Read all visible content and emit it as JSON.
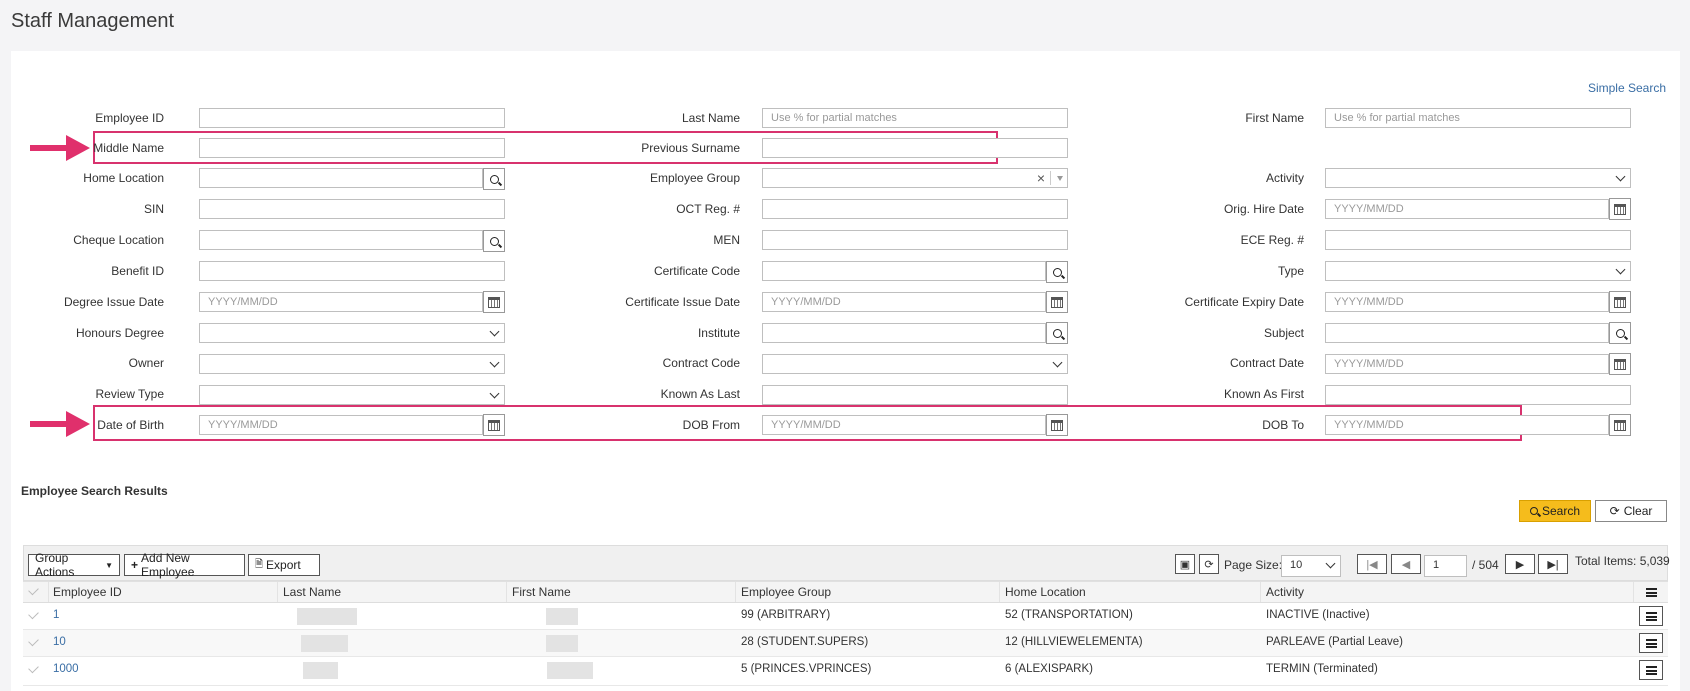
{
  "page": {
    "title": "Staff Management",
    "simple_search": "Simple Search"
  },
  "form": {
    "employee_id": "Employee ID",
    "last_name": "Last Name",
    "first_name": "First Name",
    "middle_name": "Middle Name",
    "previous_surname": "Previous Surname",
    "home_location": "Home Location",
    "employee_group": "Employee Group",
    "activity": "Activity",
    "sin": "SIN",
    "oct_reg": "OCT Reg. #",
    "orig_hire_date": "Orig. Hire Date",
    "cheque_location": "Cheque Location",
    "men": "MEN",
    "ece_reg": "ECE Reg. #",
    "benefit_id": "Benefit ID",
    "certificate_code": "Certificate Code",
    "type": "Type",
    "degree_issue_date": "Degree Issue Date",
    "certificate_issue_date": "Certificate Issue Date",
    "certificate_expiry_date": "Certificate Expiry Date",
    "honours_degree": "Honours Degree",
    "institute": "Institute",
    "subject": "Subject",
    "owner": "Owner",
    "contract_code": "Contract Code",
    "contract_date": "Contract Date",
    "review_type": "Review Type",
    "known_as_last": "Known As Last",
    "known_as_first": "Known As First",
    "date_of_birth": "Date of Birth",
    "dob_from": "DOB From",
    "dob_to": "DOB To",
    "partial_placeholder": "Use % for partial matches",
    "date_placeholder": "YYYY/MM/DD",
    "clear_x": "×"
  },
  "actions": {
    "search": "Search",
    "clear": "Clear"
  },
  "results": {
    "title": "Employee Search Results",
    "group_actions": "Group Actions",
    "add_new": "Add New Employee",
    "export": "Export",
    "page_size_label": "Page Size:",
    "page_size": "10",
    "current_page": "1",
    "total_pages": "/ 504",
    "total_items": "Total Items: 5,039",
    "columns": [
      "Employee ID",
      "Last Name",
      "First Name",
      "Employee Group",
      "Home Location",
      "Activity"
    ],
    "rows": [
      {
        "id": "1",
        "group": "99 (ARBITRARY)",
        "location": "52 (TRANSPORTATION)",
        "activity": "INACTIVE (Inactive)"
      },
      {
        "id": "10",
        "group": "28 (STUDENT.SUPERS)",
        "location": "12 (HILLVIEWELEMENTA)",
        "activity": "PARLEAVE (Partial Leave)"
      },
      {
        "id": "1000",
        "group": "5 (PRINCES.VPRINCES)",
        "location": "6 (ALEXISPARK)",
        "activity": "TERMIN (Terminated)"
      }
    ]
  },
  "colors": {
    "highlight": "#d8326e",
    "accent": "#f5bc1c",
    "link": "#3a6ea5"
  }
}
